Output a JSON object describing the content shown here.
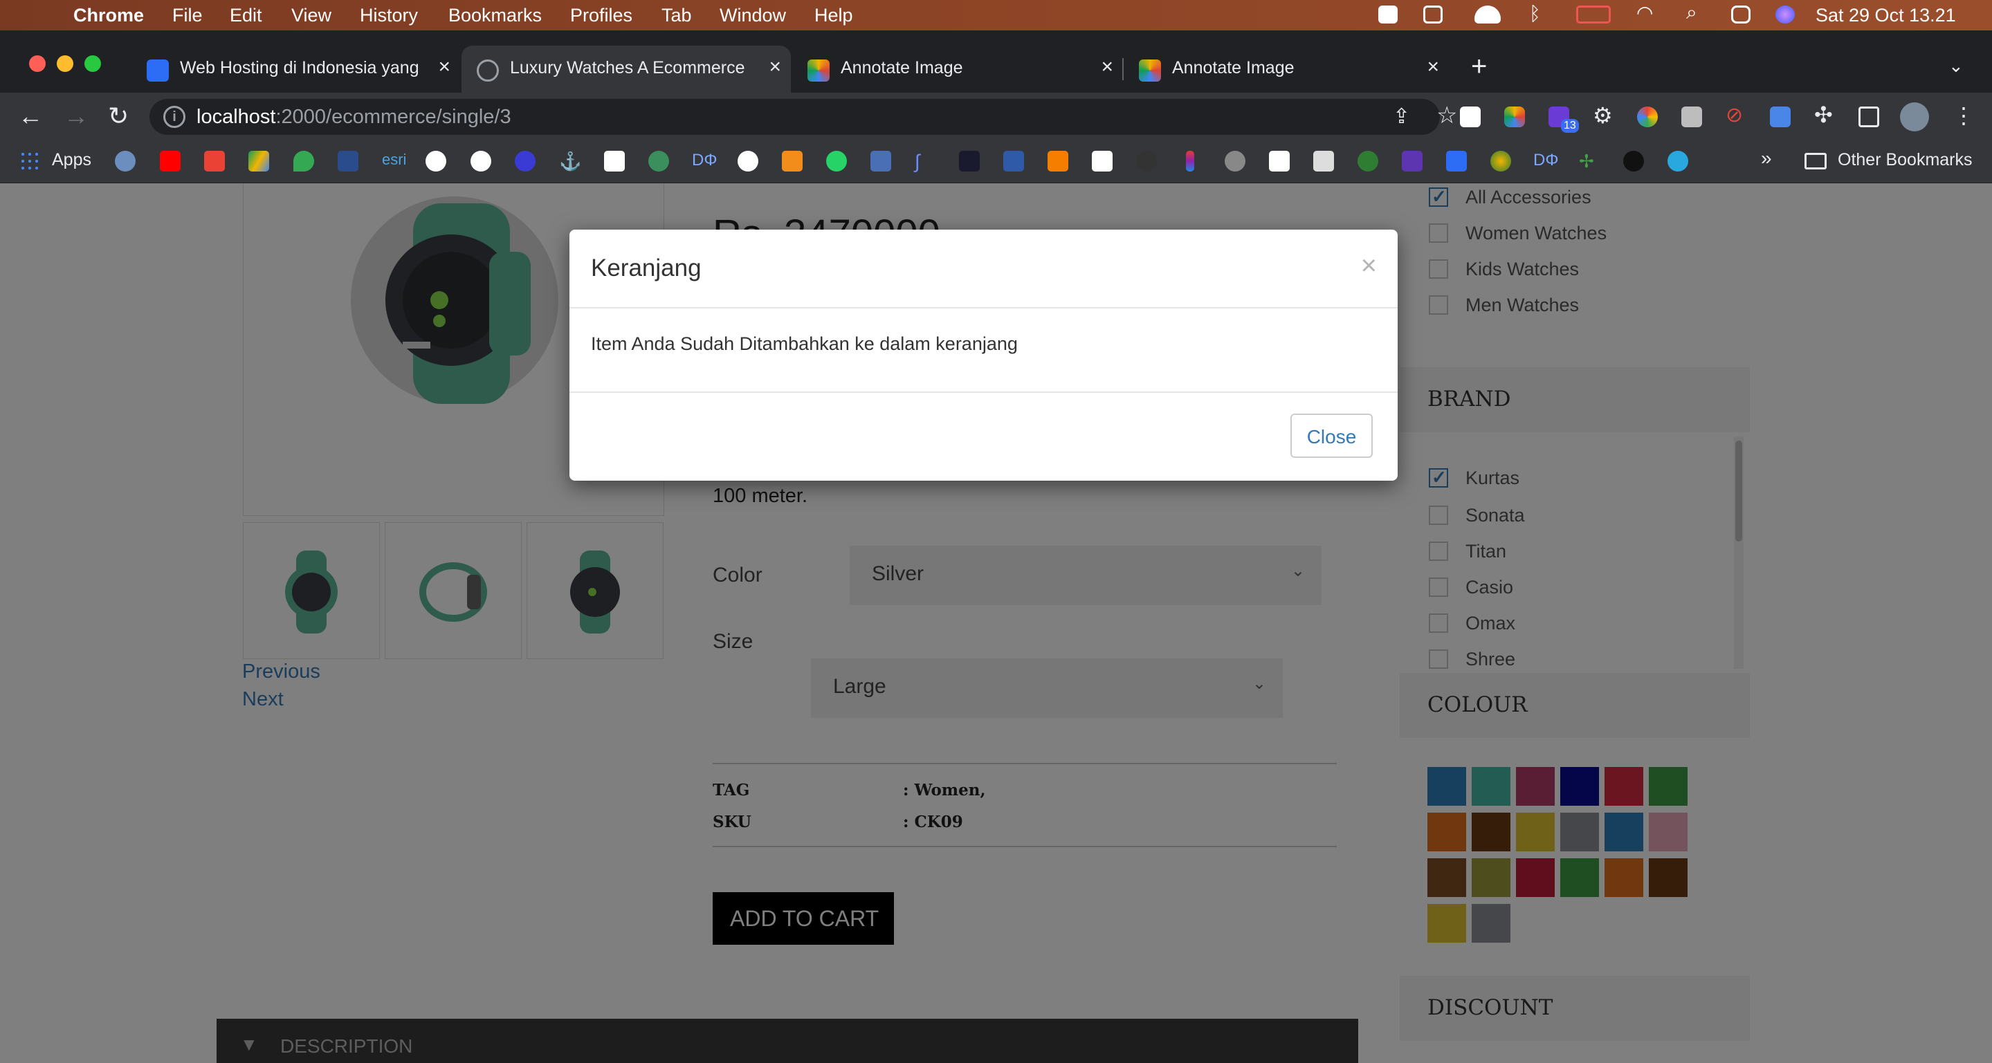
{
  "menubar": {
    "app": "Chrome",
    "items": [
      "File",
      "Edit",
      "View",
      "History",
      "Bookmarks",
      "Profiles",
      "Tab",
      "Window",
      "Help"
    ],
    "clock": "Sat 29 Oct  13.21"
  },
  "tabs": [
    {
      "title": "Web Hosting di Indonesia yang",
      "active": false
    },
    {
      "title": "Luxury Watches A Ecommerce",
      "active": true
    },
    {
      "title": "Annotate Image",
      "active": false
    },
    {
      "title": "Annotate Image",
      "active": false
    }
  ],
  "toolbar": {
    "url_host": "localhost",
    "url_path": ":2000/ecommerce/single/3",
    "extension_badge": "13"
  },
  "bookmarks": {
    "apps_label": "Apps",
    "other_label": "Other Bookmarks",
    "overflow": "»"
  },
  "product": {
    "price": "Rs. 3470000",
    "description_tail": "100 meter.",
    "gallery_prev": "Previous",
    "gallery_next": "Next",
    "color_label": "Color",
    "color_value": "Silver",
    "size_label": "Size",
    "size_value": "Large",
    "tag_label": "TAG",
    "tag_value": ": Women,",
    "sku_label": "SKU",
    "sku_value": ": CK09",
    "add_to_cart": "ADD TO CART",
    "description_tab": "DESCRIPTION"
  },
  "sidebar": {
    "categories": [
      {
        "label": "All Accessories",
        "checked": true
      },
      {
        "label": "Women Watches",
        "checked": false
      },
      {
        "label": "Kids Watches",
        "checked": false
      },
      {
        "label": "Men Watches",
        "checked": false
      }
    ],
    "brand_heading": "BRAND",
    "brands": [
      {
        "label": "Kurtas",
        "checked": true
      },
      {
        "label": "Sonata",
        "checked": false
      },
      {
        "label": "Titan",
        "checked": false
      },
      {
        "label": "Casio",
        "checked": false
      },
      {
        "label": "Omax",
        "checked": false
      },
      {
        "label": "Shree",
        "checked": false
      }
    ],
    "colour_heading": "COLOUR",
    "swatches": [
      "#2f7fbd",
      "#46b9a4",
      "#b33a68",
      "#0a0a92",
      "#d62a43",
      "#3f9d45",
      "#e36f1c",
      "#6b3a14",
      "#e1c233",
      "#8a8f97",
      "#2f7fbd",
      "#e9a7b9",
      "#7e4e22",
      "#9a9a3a",
      "#c11a3a",
      "#3f9d45",
      "#e36f1c",
      "#6b3a14",
      "#e1c233",
      "#8a8f97"
    ],
    "discount_heading": "DISCOUNT"
  },
  "modal": {
    "title": "Keranjang",
    "close_x": "×",
    "body": "Item Anda Sudah Ditambahkan ke dalam keranjang",
    "close_button": "Close"
  }
}
